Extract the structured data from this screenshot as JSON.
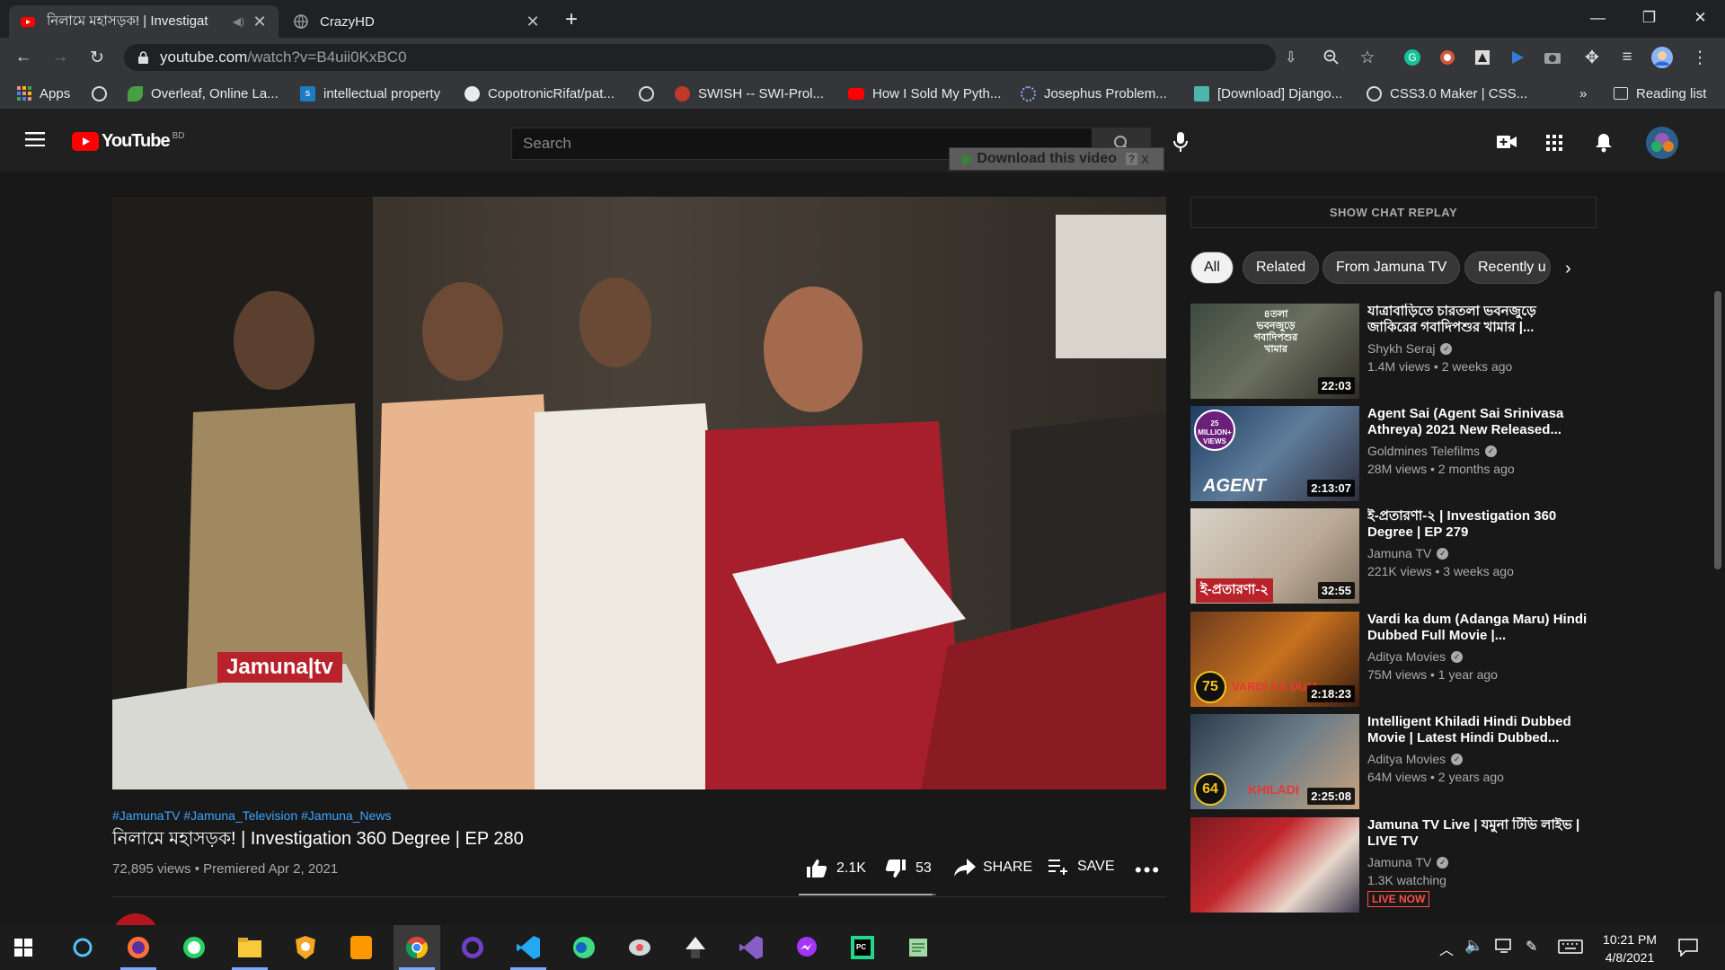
{
  "browser": {
    "tabs": [
      {
        "title": "নিলামে মহাসড়ক! | Investigat",
        "active": true
      },
      {
        "title": "CrazyHD",
        "active": false
      }
    ],
    "address": {
      "host": "youtube.com",
      "path": "/watch?v=B4uii0KxBC0"
    },
    "bookmarks": [
      {
        "label": "Apps",
        "icon": "apps-grid-icon"
      },
      {
        "label": "",
        "icon": "globe-icon"
      },
      {
        "label": "Overleaf, Online La...",
        "icon": "overleaf-icon"
      },
      {
        "label": "intellectual property",
        "icon": "scribd-icon"
      },
      {
        "label": "CopotronicRifat/pat...",
        "icon": "github-icon"
      },
      {
        "label": "",
        "icon": "globe-icon"
      },
      {
        "label": "SWISH -- SWI-Prol...",
        "icon": "swish-icon"
      },
      {
        "label": "How I Sold My Pyth...",
        "icon": "youtube-icon"
      },
      {
        "label": "Josephus Problem...",
        "icon": "loading-icon"
      },
      {
        "label": "[Download] Django...",
        "icon": "page-icon"
      },
      {
        "label": "CSS3.0 Maker | CSS...",
        "icon": "globe-icon"
      }
    ],
    "more_bookmarks": "»",
    "reading_list": "Reading list"
  },
  "youtube": {
    "logo_text": "YouTube",
    "region": "BD",
    "search_placeholder": "Search",
    "download_label": "Download this video",
    "download_help": "?",
    "download_close": "X",
    "video": {
      "watermark": "Jamuna|tv",
      "hashtags": "#JamunaTV #Jamuna_Television #Jamuna_News",
      "title": "নিলামে মহাসড়ক! | Investigation 360 Degree | EP 280",
      "meta": "72,895 views • Premiered Apr 2, 2021",
      "likes": "2.1K",
      "dislikes": "53",
      "like_ratio": 0.975,
      "share": "SHARE",
      "save": "SAVE"
    },
    "chat_replay": "SHOW CHAT REPLAY",
    "chips": [
      "All",
      "Related",
      "From Jamuna TV",
      "Recently u"
    ],
    "recommendations": [
      {
        "title": "যাত্রাবাড়িতে চারতলা ভবনজুড়ে জাকিরের গবাদিপশুর খামার |...",
        "channel": "Shykh Seraj",
        "stats": "1.4M views • 2 weeks ago",
        "duration": "22:03",
        "badge": "৪তলা ভবনজুড়ে গবাদিপশুর খামার"
      },
      {
        "title": "Agent Sai (Agent Sai Srinivasa Athreya) 2021 New Released...",
        "channel": "Goldmines Telefilms",
        "stats": "28M views • 2 months ago",
        "duration": "2:13:07",
        "badge": "25 MILLION+ VIEWS",
        "overlay": "AGENT"
      },
      {
        "title": "ই-প্রতারণা-২ | Investigation 360 Degree | EP 279",
        "channel": "Jamuna TV",
        "stats": "221K views • 3 weeks ago",
        "duration": "32:55",
        "overlay": "ই-প্রতারণা-২"
      },
      {
        "title": "Vardi ka dum (Adanga Maru) Hindi Dubbed Full Movie |...",
        "channel": "Aditya Movies",
        "stats": "75M views • 1 year ago",
        "duration": "2:18:23",
        "badge": "75",
        "overlay": "VARDI KA DUM"
      },
      {
        "title": "Intelligent Khiladi Hindi Dubbed Movie | Latest Hindi Dubbed...",
        "channel": "Aditya Movies",
        "stats": "64M views • 2 years ago",
        "duration": "2:25:08",
        "badge": "64",
        "overlay": "KHILADI"
      },
      {
        "title": "Jamuna TV Live | যমুনা টিভি লাইভ | LIVE TV",
        "channel": "Jamuna TV",
        "stats": "1.3K watching",
        "live": "LIVE NOW"
      }
    ]
  },
  "taskbar": {
    "time": "10:21 PM",
    "date": "4/8/2021",
    "apps": [
      "windows-start-icon",
      "search-cortana-icon",
      "firefox-icon",
      "whatsapp-icon",
      "file-explorer-icon",
      "brave-icon",
      "sublime-icon",
      "chrome-icon",
      "github-desktop-icon",
      "vscode-icon",
      "kotlin-icon",
      "anydesk-icon",
      "inkscape-icon",
      "visual-studio-icon",
      "messenger-icon",
      "pycharm-icon",
      "notepad-icon"
    ]
  },
  "colors": {
    "yt_red": "#ff0000",
    "link_blue": "#3ea6ff",
    "chrome_dark": "#202124",
    "yt_bg": "#181818"
  }
}
